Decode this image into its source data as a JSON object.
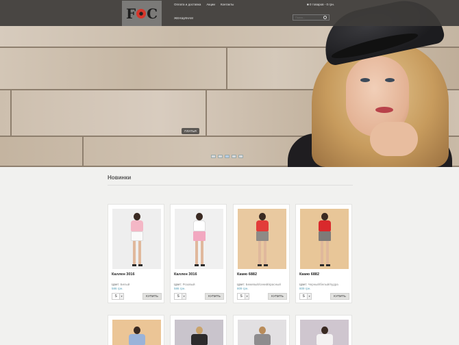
{
  "header": {
    "logo_left": "F",
    "logo_right": "C",
    "nav": [
      "Оплата и доставка",
      "Акции",
      "Контакты"
    ],
    "cart": "0 товаров - 0 грн.",
    "category": "ЖЕНЩИНАМ",
    "search_placeholder": "Поиск..."
  },
  "hero": {
    "button": "ПЛАТЬЯ",
    "slides": 5,
    "active_slide": 3
  },
  "section": {
    "title": "Новинки"
  },
  "products": [
    {
      "name": "Каллен 3016",
      "color_label": "Цвет:",
      "color": "Белый",
      "price": "586 грн.",
      "size": "S",
      "buy": "КУПИТЬ"
    },
    {
      "name": "Каллен 3016",
      "color_label": "Цвет:",
      "color": "Розовый",
      "price": "586 грн.",
      "size": "S",
      "buy": "КУПИТЬ"
    },
    {
      "name": "Камю 6882",
      "color_label": "Цвет:",
      "color": "Бежевый/синий/красный",
      "price": "809 грн.",
      "size": "S",
      "buy": "КУПИТЬ"
    },
    {
      "name": "Камю 6882",
      "color_label": "Цвет:",
      "color": "Черный/белый/пудра",
      "price": "809 грн.",
      "size": "S",
      "buy": "КУПИТЬ"
    }
  ],
  "colors": {
    "accent_price": "#5aa0b8",
    "topbar": "#3e3c3a"
  }
}
